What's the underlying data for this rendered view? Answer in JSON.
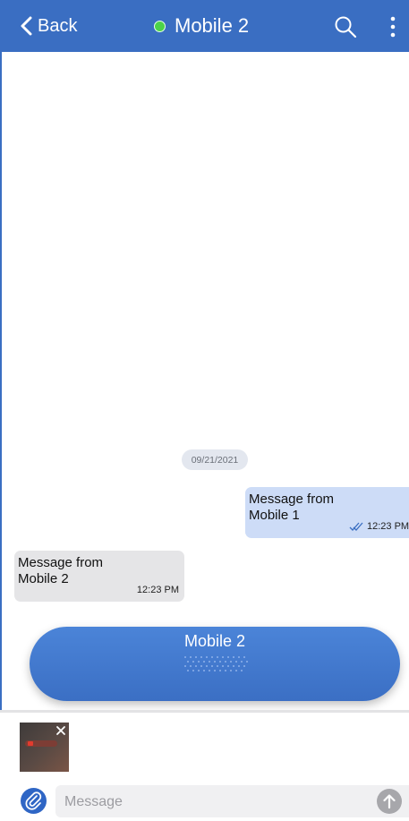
{
  "header": {
    "back_label": "Back",
    "title": "Mobile 2",
    "status_color": "#4cd34a",
    "background_color": "#3a6ec2",
    "icons": [
      "chevron-left-icon",
      "search-icon",
      "more-vertical-icon"
    ]
  },
  "chat": {
    "date": "09/21/2021",
    "outgoing": {
      "text": "Message from Mobile 1",
      "time": "12:23 PM",
      "status_icon": "double-check-icon"
    },
    "incoming": {
      "text": "Message from Mobile 2",
      "time": "12:23 PM"
    }
  },
  "call_banner": {
    "label": "Mobile 2"
  },
  "composer": {
    "attachment_thumbnail": "screenshot",
    "placeholder": "Message",
    "value": "",
    "icons": [
      "paperclip-icon",
      "close-icon",
      "arrow-up-icon"
    ]
  }
}
